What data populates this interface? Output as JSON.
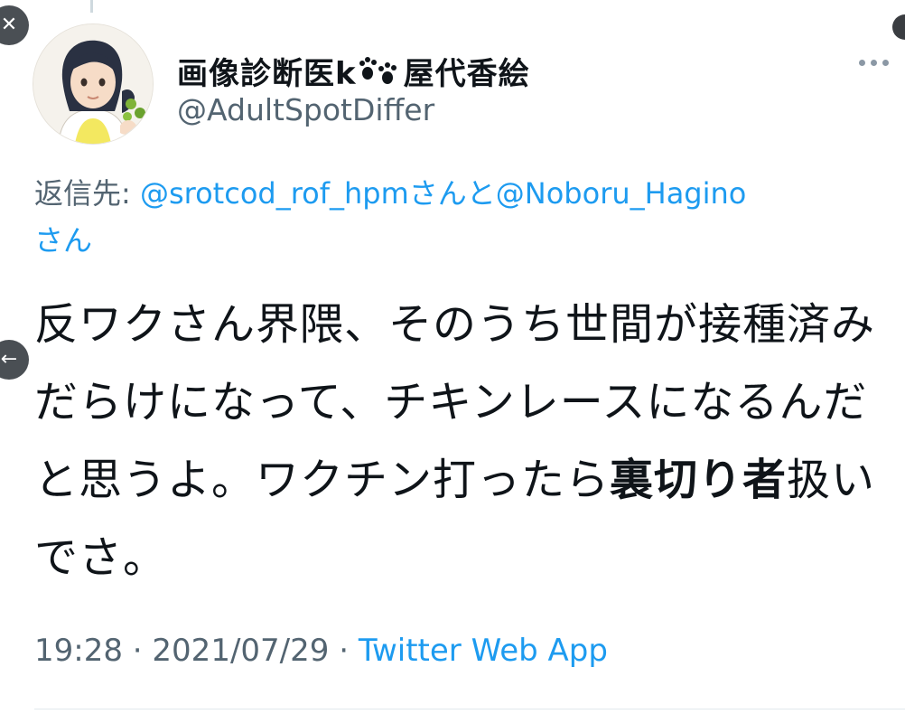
{
  "tweet": {
    "display_name_prefix": "画像診断医k",
    "display_name_suffix": "屋代香絵",
    "handle": "@AdultSpotDiffer",
    "reply_label": "返信先:",
    "reply_mention_1": "@srotcod_rof_hpm",
    "reply_joiner": "さんと",
    "reply_mention_2": "@Noboru_Hagino",
    "reply_suffix": "さん",
    "text_part_1": "反ワクさん界隈、そのうち世間が接種済みだらけになって、チキンレースになるんだと思うよ。ワクチン打ったら",
    "text_bold": "裏切り者",
    "text_part_2": "扱いでさ。",
    "time": "19:28",
    "date": "2021/07/29",
    "separator": " · ",
    "source": "Twitter Web App"
  },
  "icons": {
    "close": "close-icon",
    "prev": "arrow-left-icon",
    "more": "more-icon",
    "paw": "paw-icon"
  },
  "colors": {
    "link": "#1d9bf0",
    "secondary_text": "#536471",
    "primary_text": "#0f1419"
  }
}
